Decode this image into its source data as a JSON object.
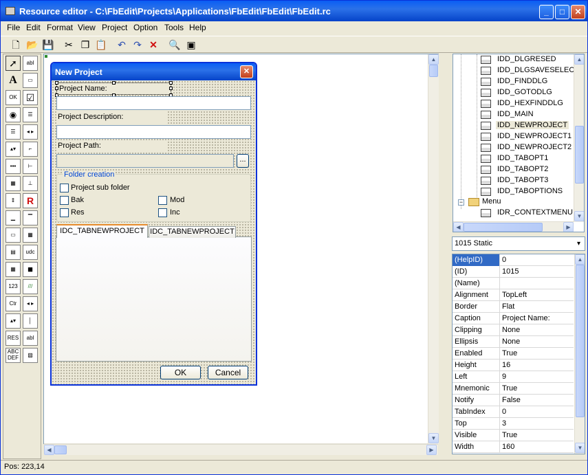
{
  "window": {
    "title": "Resource editor - C:\\FbEdit\\Projects\\Applications\\FbEdit\\FbEdit\\FbEdit.rc"
  },
  "menu": [
    "File",
    "Edit",
    "Format",
    "View",
    "Project",
    "Option",
    "Tools",
    "Help"
  ],
  "toolbar_icons": [
    "new-file-icon",
    "open-folder-icon",
    "save-icon",
    "cut-icon",
    "copy-icon",
    "paste-icon",
    "undo-icon",
    "redo-icon",
    "delete-icon",
    "preview-icon",
    "grid-icon"
  ],
  "toolbox": {
    "text_tools": {
      "label": "abl",
      "static": "A",
      "button": "OK",
      "spin": "udc",
      "ctr": "Ctr",
      "res": "RES",
      "abc": "ABC DEF",
      "num": "123",
      "abl2": "abl"
    }
  },
  "dialog": {
    "title": "New Project",
    "project_name_label": "Project Name:",
    "project_description_label": "Project Description:",
    "project_path_label": "Project Path:",
    "browse_label": "...",
    "group_label": "Folder creation",
    "checkboxes": {
      "sub_folder": "Project sub folder",
      "bak": "Bak",
      "mod": "Mod",
      "res": "Res",
      "inc": "Inc"
    },
    "tabs": [
      "IDC_TABNEWPROJECT",
      "IDC_TABNEWPROJECT"
    ],
    "ok_label": "OK",
    "cancel_label": "Cancel"
  },
  "tree": {
    "items": [
      {
        "label": "IDD_DLGRESED"
      },
      {
        "label": "IDD_DLGSAVESELECTIC"
      },
      {
        "label": "IDD_FINDDLG"
      },
      {
        "label": "IDD_GOTODLG"
      },
      {
        "label": "IDD_HEXFINDDLG"
      },
      {
        "label": "IDD_MAIN"
      },
      {
        "label": "IDD_NEWPROJECT",
        "selected": true
      },
      {
        "label": "IDD_NEWPROJECT1"
      },
      {
        "label": "IDD_NEWPROJECT2"
      },
      {
        "label": "IDD_TABOPT1"
      },
      {
        "label": "IDD_TABOPT2"
      },
      {
        "label": "IDD_TABOPT3"
      },
      {
        "label": "IDD_TABOPTIONS"
      }
    ],
    "folder": "Menu",
    "menu_item": "IDR_CONTEXTMENU"
  },
  "control_combo": {
    "value": "1015 Static"
  },
  "properties": [
    {
      "key": "(HelpID)",
      "value": "0"
    },
    {
      "key": "(ID)",
      "value": "1015"
    },
    {
      "key": "(Name)",
      "value": ""
    },
    {
      "key": "Alignment",
      "value": "TopLeft"
    },
    {
      "key": "Border",
      "value": "Flat"
    },
    {
      "key": "Caption",
      "value": "Project Name:"
    },
    {
      "key": "Clipping",
      "value": "None"
    },
    {
      "key": "Ellipsis",
      "value": "None"
    },
    {
      "key": "Enabled",
      "value": "True"
    },
    {
      "key": "Height",
      "value": "16"
    },
    {
      "key": "Left",
      "value": "9"
    },
    {
      "key": "Mnemonic",
      "value": "True"
    },
    {
      "key": "Notify",
      "value": "False"
    },
    {
      "key": "TabIndex",
      "value": "0"
    },
    {
      "key": "Top",
      "value": "3"
    },
    {
      "key": "Visible",
      "value": "True"
    },
    {
      "key": "Width",
      "value": "160"
    }
  ],
  "status": {
    "pos": "Pos: 223,14"
  },
  "colors": {
    "titlebar": "#0a5ef5",
    "selection": "#316ac5",
    "window": "#ece9d8"
  }
}
